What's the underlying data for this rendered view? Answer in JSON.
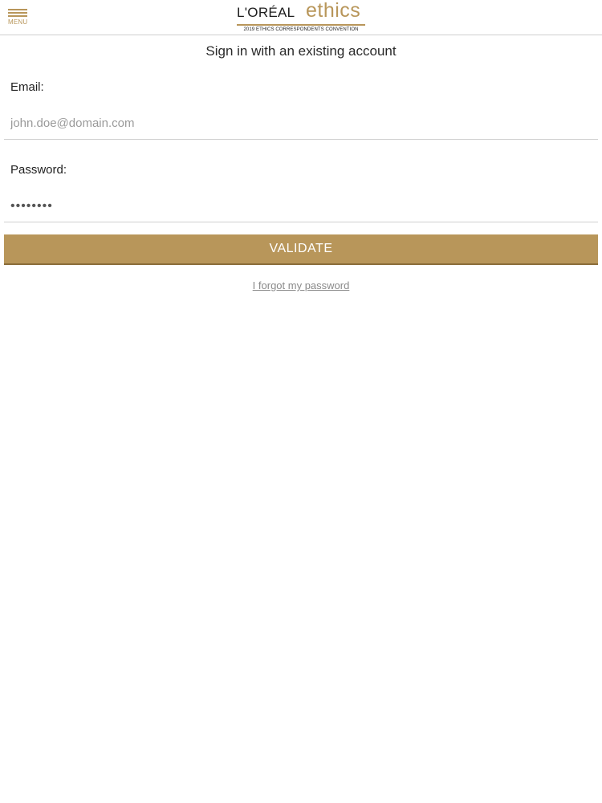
{
  "header": {
    "menu_label": "MENU",
    "menu_icon": "hamburger-icon",
    "logo": {
      "brand": "L'ORÉAL",
      "product": "ethics",
      "tagline": "2019 ETHICS CORRESPONDENTS CONVENTION"
    }
  },
  "form": {
    "title": "Sign in with an existing account",
    "email": {
      "label": "Email:",
      "placeholder": "john.doe@domain.com",
      "value": ""
    },
    "password": {
      "label": "Password:",
      "value": "••••••••"
    },
    "validate_label": "VALIDATE",
    "forgot_label": "I forgot my password"
  },
  "colors": {
    "accent": "#b8965a",
    "divider": "#cfcfcf",
    "link": "#8a8a8a"
  }
}
